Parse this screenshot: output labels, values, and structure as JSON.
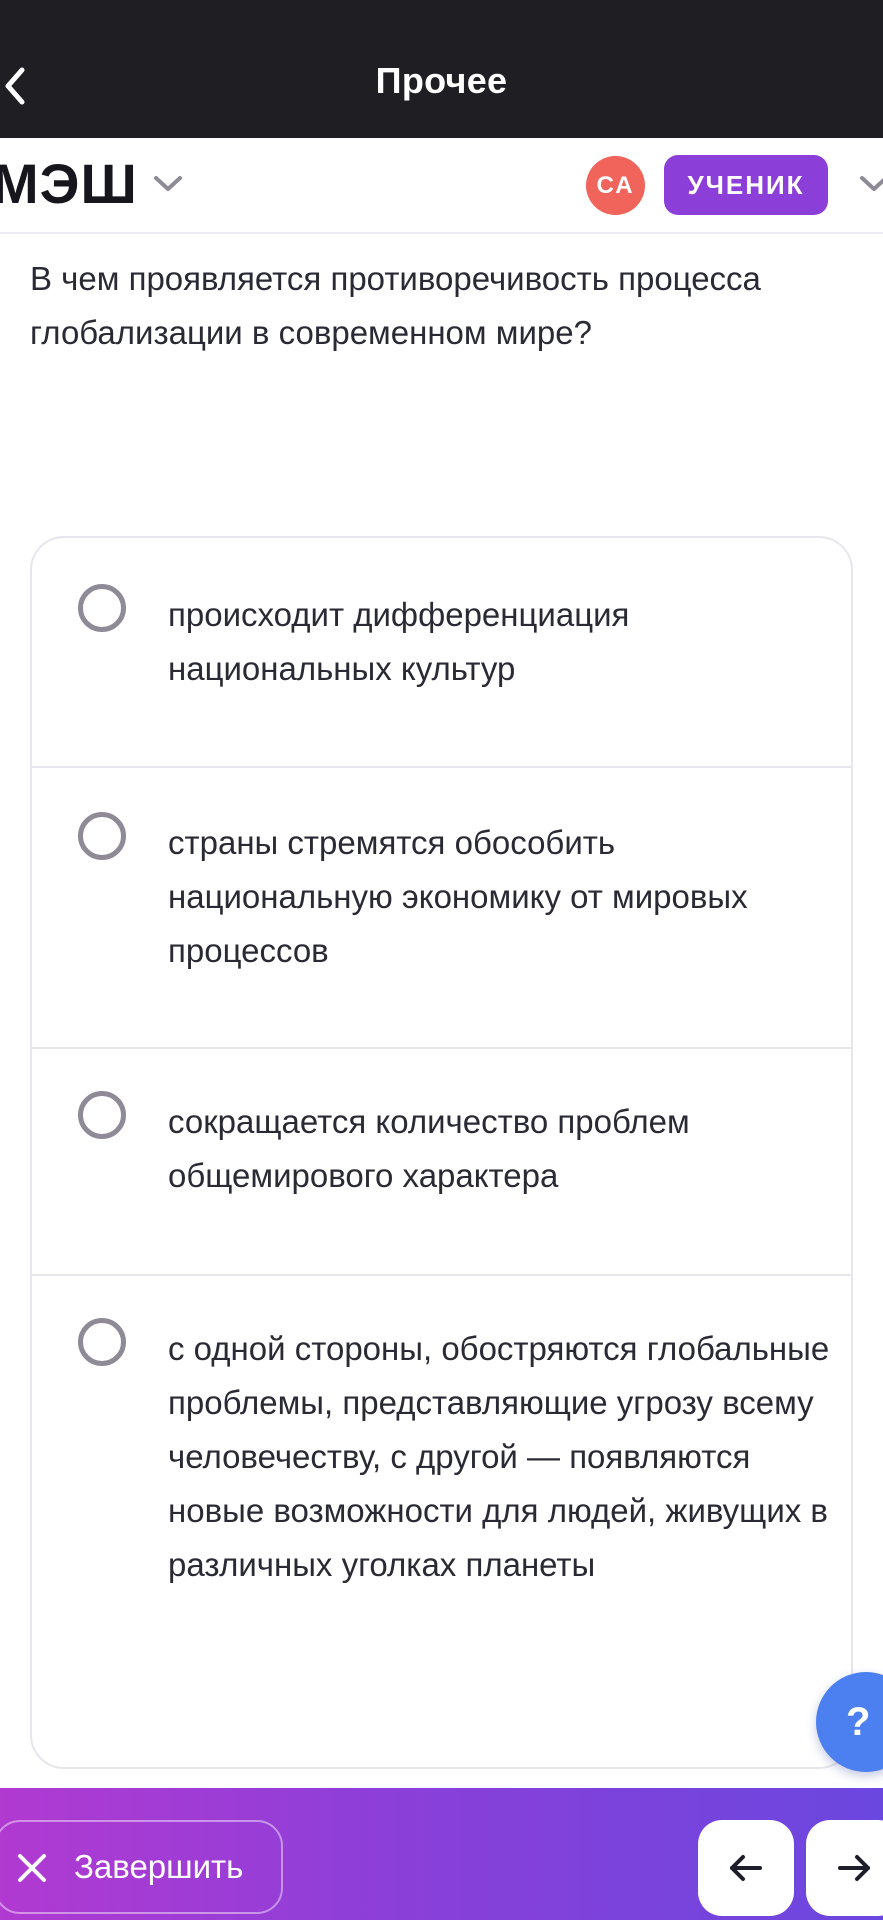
{
  "topbar": {
    "title": "Прочее",
    "back_icon": "chevron-left-icon"
  },
  "header": {
    "logo_text": "МЭШ",
    "avatar_initials": "СА",
    "role_label": "УЧЕНИК",
    "colors": {
      "avatar": "#f0645c",
      "role_pill": "#8c3fd8"
    }
  },
  "question": {
    "text": "В чем проявляется противоречивость процесса глобализации в современном мире?"
  },
  "answers": [
    {
      "text": "происходит дифференциация национальных культур",
      "selected": false
    },
    {
      "text": "страны стремятся обособить национальную экономику от мировых процессов",
      "selected": false
    },
    {
      "text": "сокращается количество проблем общемирового характера",
      "selected": false
    },
    {
      "text": "с одной стороны, обостряются глобальные проблемы, представляющие угрозу всему человечеству, с другой — появляются новые возможности для людей, живущих в различных уголках планеты",
      "selected": false
    }
  ],
  "help": {
    "label": "?"
  },
  "bottombar": {
    "finish_label": "Завершить",
    "finish_icon": "close-icon",
    "prev_icon": "arrow-left-icon",
    "next_icon": "arrow-right-icon",
    "gradient": [
      "#b13ad1",
      "#6a47df"
    ]
  }
}
